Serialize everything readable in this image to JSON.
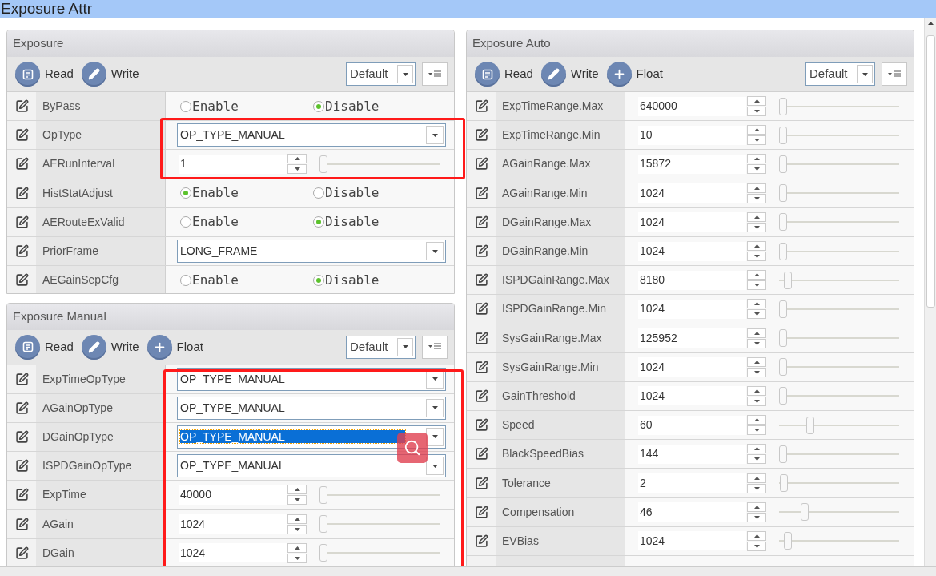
{
  "window": {
    "title": "Exposure Attr"
  },
  "panels": [
    {
      "title": "Exposure",
      "toolbar": [
        {
          "kind": "read",
          "label": "Read"
        },
        {
          "kind": "write",
          "label": "Write"
        }
      ],
      "preset": "Default",
      "rows": [
        {
          "kind": "radio",
          "label": "ByPass",
          "options": [
            {
              "label": "Enable",
              "selected": false
            },
            {
              "label": "Disable",
              "selected": true
            }
          ]
        },
        {
          "kind": "select",
          "label": "OpType",
          "value": "OP_TYPE_MANUAL",
          "highlighted": false
        },
        {
          "kind": "spin",
          "label": "AERunInterval",
          "value": "1",
          "level": 0
        },
        {
          "kind": "radio",
          "label": "HistStatAdjust",
          "options": [
            {
              "label": "Enable",
              "selected": true
            },
            {
              "label": "Disable",
              "selected": false
            }
          ]
        },
        {
          "kind": "radio",
          "label": "AERouteExValid",
          "options": [
            {
              "label": "Enable",
              "selected": false
            },
            {
              "label": "Disable",
              "selected": true
            }
          ]
        },
        {
          "kind": "select",
          "label": "PriorFrame",
          "value": "LONG_FRAME",
          "highlighted": false
        },
        {
          "kind": "radio",
          "label": "AEGainSepCfg",
          "options": [
            {
              "label": "Enable",
              "selected": false
            },
            {
              "label": "Disable",
              "selected": true
            }
          ]
        }
      ]
    },
    {
      "title": "Exposure Manual",
      "toolbar": [
        {
          "kind": "read",
          "label": "Read"
        },
        {
          "kind": "write",
          "label": "Write"
        },
        {
          "kind": "float",
          "label": "Float"
        }
      ],
      "preset": "Default",
      "rows": [
        {
          "kind": "select",
          "label": "ExpTimeOpType",
          "value": "OP_TYPE_MANUAL",
          "highlighted": false
        },
        {
          "kind": "select",
          "label": "AGainOpType",
          "value": "OP_TYPE_MANUAL",
          "highlighted": false
        },
        {
          "kind": "select",
          "label": "DGainOpType",
          "value": "OP_TYPE_MANUAL",
          "highlighted": true
        },
        {
          "kind": "select",
          "label": "ISPDGainOpType",
          "value": "OP_TYPE_MANUAL",
          "highlighted": false
        },
        {
          "kind": "spin",
          "label": "ExpTime",
          "value": "40000",
          "level": 0
        },
        {
          "kind": "spin",
          "label": "AGain",
          "value": "1024",
          "level": 0
        },
        {
          "kind": "spin",
          "label": "DGain",
          "value": "1024",
          "level": 0
        }
      ]
    },
    {
      "title": "Exposure Auto",
      "toolbar": [
        {
          "kind": "read",
          "label": "Read"
        },
        {
          "kind": "write",
          "label": "Write"
        },
        {
          "kind": "float",
          "label": "Float"
        }
      ],
      "preset": "Default",
      "rows": [
        {
          "kind": "spin",
          "label": "ExpTimeRange.Max",
          "value": "640000",
          "level": 0
        },
        {
          "kind": "spin",
          "label": "ExpTimeRange.Min",
          "value": "10",
          "level": 0
        },
        {
          "kind": "spin",
          "label": "AGainRange.Max",
          "value": "15872",
          "level": 0
        },
        {
          "kind": "spin",
          "label": "AGainRange.Min",
          "value": "1024",
          "level": 0
        },
        {
          "kind": "spin",
          "label": "DGainRange.Max",
          "value": "1024",
          "level": 0
        },
        {
          "kind": "spin",
          "label": "DGainRange.Min",
          "value": "1024",
          "level": 0
        },
        {
          "kind": "spin",
          "label": "ISPDGainRange.Max",
          "value": "8180",
          "level": 0.04
        },
        {
          "kind": "spin",
          "label": "ISPDGainRange.Min",
          "value": "1024",
          "level": 0
        },
        {
          "kind": "spin",
          "label": "SysGainRange.Max",
          "value": "125952",
          "level": 0
        },
        {
          "kind": "spin",
          "label": "SysGainRange.Min",
          "value": "1024",
          "level": 0
        },
        {
          "kind": "spin",
          "label": "GainThreshold",
          "value": "1024",
          "level": 0
        },
        {
          "kind": "spin",
          "label": "Speed",
          "value": "60",
          "level": 0.24
        },
        {
          "kind": "spin",
          "label": "BlackSpeedBias",
          "value": "144",
          "level": 0
        },
        {
          "kind": "spin",
          "label": "Tolerance",
          "value": "2",
          "level": 0.01
        },
        {
          "kind": "spin",
          "label": "Compensation",
          "value": "46",
          "level": 0.19
        },
        {
          "kind": "spin",
          "label": "EVBias",
          "value": "1024",
          "level": 0.04
        },
        {
          "kind": "blank"
        }
      ]
    }
  ]
}
